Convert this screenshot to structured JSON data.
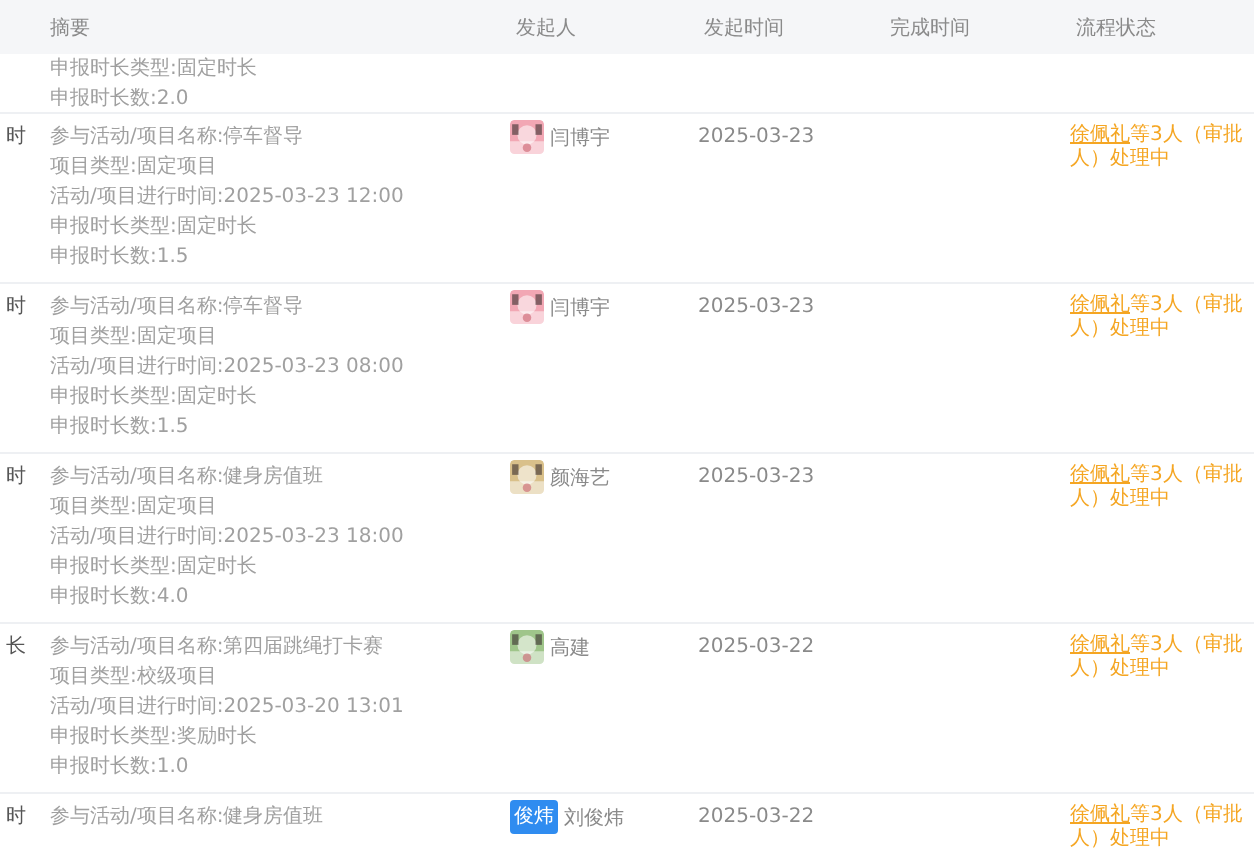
{
  "table": {
    "columns": [
      "摘要",
      "发起人",
      "发起时间",
      "完成时间",
      "流程状态"
    ],
    "partial_row": {
      "summary": [
        "申报时长类型:固定时长",
        "申报时长数:2.0"
      ]
    },
    "rows": [
      {
        "column_0": "时",
        "summary": [
          "参与活动/项目名称:停车督导",
          "项目类型:固定项目",
          "活动/项目进行时间:2025-03-23 12:00",
          "申报时长类型:固定时长",
          "申报时长数:1.5"
        ],
        "initiator": {
          "name": "闫博宇"
        },
        "start": "2025-03-23",
        "status": {
          "approver": "徐佩礼",
          "rest": "等3人（审批人）处理中"
        }
      },
      {
        "column_0": "时",
        "summary": [
          "参与活动/项目名称:停车督导",
          "项目类型:固定项目",
          "活动/项目进行时间:2025-03-23 08:00",
          "申报时长类型:固定时长",
          "申报时长数:1.5"
        ],
        "initiator": {
          "name": "闫博宇"
        },
        "start": "2025-03-23",
        "status": {
          "approver": "徐佩礼",
          "rest": "等3人（审批人）处理中"
        }
      },
      {
        "column_0": "时",
        "summary": [
          "参与活动/项目名称:健身房值班",
          "项目类型:固定项目",
          "活动/项目进行时间:2025-03-23 18:00",
          "申报时长类型:固定时长",
          "申报时长数:4.0"
        ],
        "initiator": {
          "name": "颜海艺"
        },
        "start": "2025-03-23",
        "status": {
          "approver": "徐佩礼",
          "rest": "等3人（审批人）处理中"
        }
      },
      {
        "column_0": "长",
        "summary": [
          "参与活动/项目名称:第四届跳绳打卡赛",
          "项目类型:校级项目",
          "活动/项目进行时间:2025-03-20 13:01",
          "申报时长类型:奖励时长",
          "申报时长数:1.0"
        ],
        "initiator": {
          "name": "高建"
        },
        "start": "2025-03-22",
        "status": {
          "approver": "徐佩礼",
          "rest": "等3人（审批人）处理中"
        }
      },
      {
        "column_0": "时",
        "summary": [
          "参与活动/项目名称:健身房值班"
        ],
        "initiator": {
          "avatar": {
            "kind": "text",
            "text": "俊炜",
            "color": "#2f8cf0"
          },
          "name": "刘俊炜"
        },
        "start": "2025-03-22",
        "status": {
          "approver": "徐佩礼",
          "rest": "等3人（审批人）处理中"
        }
      }
    ]
  }
}
